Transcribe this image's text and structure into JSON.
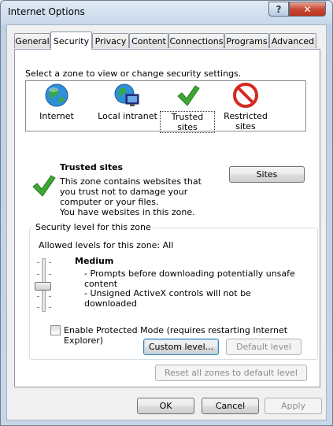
{
  "window": {
    "title": "Internet Options",
    "help_glyph": "?",
    "close_glyph": "✕"
  },
  "tabs": [
    "General",
    "Security",
    "Privacy",
    "Content",
    "Connections",
    "Programs",
    "Advanced"
  ],
  "active_tab": "Security",
  "security": {
    "prompt": "Select a zone to view or change security settings.",
    "zones": [
      {
        "label": "Internet",
        "icon": "globe-icon"
      },
      {
        "label": "Local intranet",
        "icon": "intranet-icon"
      },
      {
        "label": "Trusted sites",
        "icon": "checkmark-icon",
        "selected": true
      },
      {
        "label": "Restricted sites",
        "icon": "restricted-icon"
      }
    ],
    "zone_info": {
      "title": "Trusted sites",
      "description": "This zone contains websites that you trust not to damage your computer or your files.",
      "status": "You have websites in this zone."
    },
    "sites_button": "Sites",
    "level_group": {
      "title": "Security level for this zone",
      "allowed": "Allowed levels for this zone: All",
      "level_name": "Medium",
      "bullets": [
        "- Prompts before downloading potentially unsafe content",
        "- Unsigned ActiveX controls will not be downloaded"
      ],
      "protected_mode_label": "Enable Protected Mode (requires restarting Internet Explorer)",
      "protected_mode_checked": false,
      "custom_level_button": "Custom level...",
      "default_level_button": "Default level"
    },
    "reset_all_button": "Reset all zones to default level"
  },
  "footer": {
    "ok": "OK",
    "cancel": "Cancel",
    "apply": "Apply"
  },
  "colors": {
    "accent": "#3c7fb1",
    "check_green": "#3fa535",
    "restricted_red": "#d42a20",
    "disabled_text": "#8d8d8d"
  }
}
